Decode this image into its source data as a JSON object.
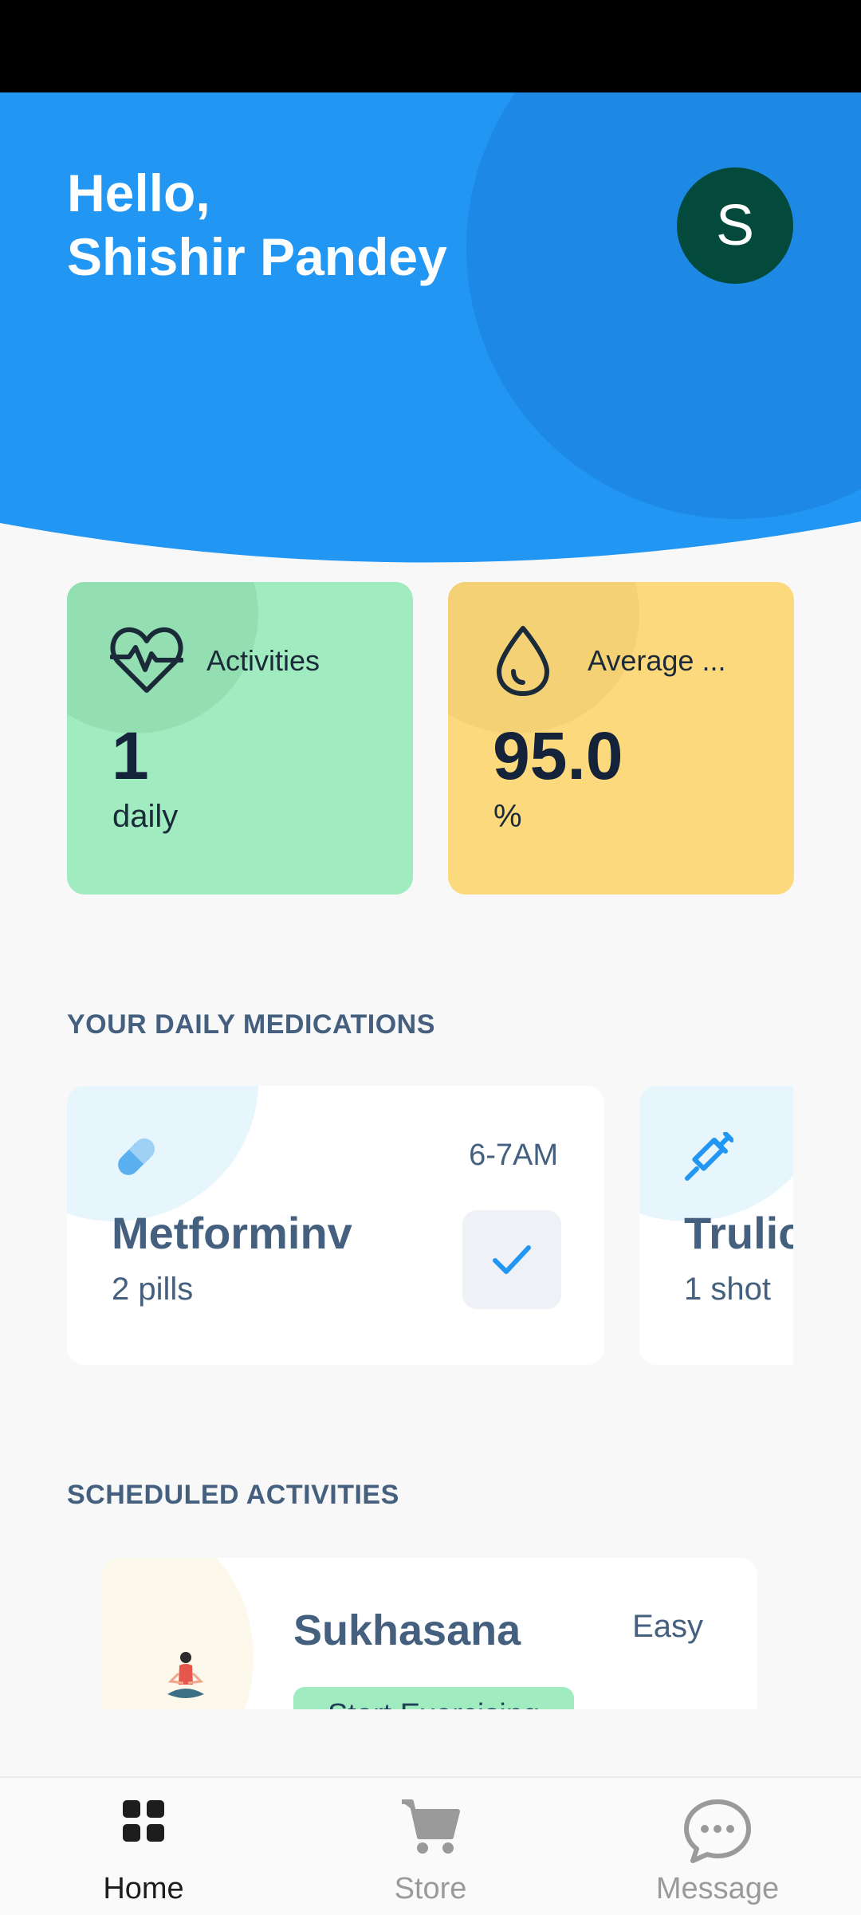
{
  "header": {
    "greeting_line1": "Hello,",
    "greeting_line2": "Shishir Pandey",
    "avatar_initial": "S",
    "background_color": "#2196f3"
  },
  "stats": [
    {
      "label": "Activities",
      "value": "1",
      "unit": "daily",
      "icon": "heartbeat-icon",
      "color": "#a0ecc0"
    },
    {
      "label": "Average ...",
      "value": "95.0",
      "unit": "%",
      "icon": "water-drop-icon",
      "color": "#fdd97d"
    }
  ],
  "medications": {
    "title": "YOUR DAILY MEDICATIONS",
    "items": [
      {
        "name": "Metforminv",
        "dose": "2 pills",
        "time": "6-7AM",
        "icon": "pill-icon",
        "taken": true
      },
      {
        "name": "Trulicity",
        "dose": "1 shot",
        "icon": "syringe-icon"
      }
    ]
  },
  "activities": {
    "title": "SCHEDULED ACTIVITIES",
    "items": [
      {
        "name": "Sukhasana",
        "difficulty": "Easy",
        "button": "Start Exercising",
        "icon": "meditation-figure-icon"
      }
    ]
  },
  "nav": {
    "items": [
      {
        "label": "Home",
        "icon": "grid-icon",
        "active": true
      },
      {
        "label": "Store",
        "icon": "cart-icon",
        "active": false
      },
      {
        "label": "Message",
        "icon": "chat-bubble-icon",
        "active": false
      }
    ]
  }
}
